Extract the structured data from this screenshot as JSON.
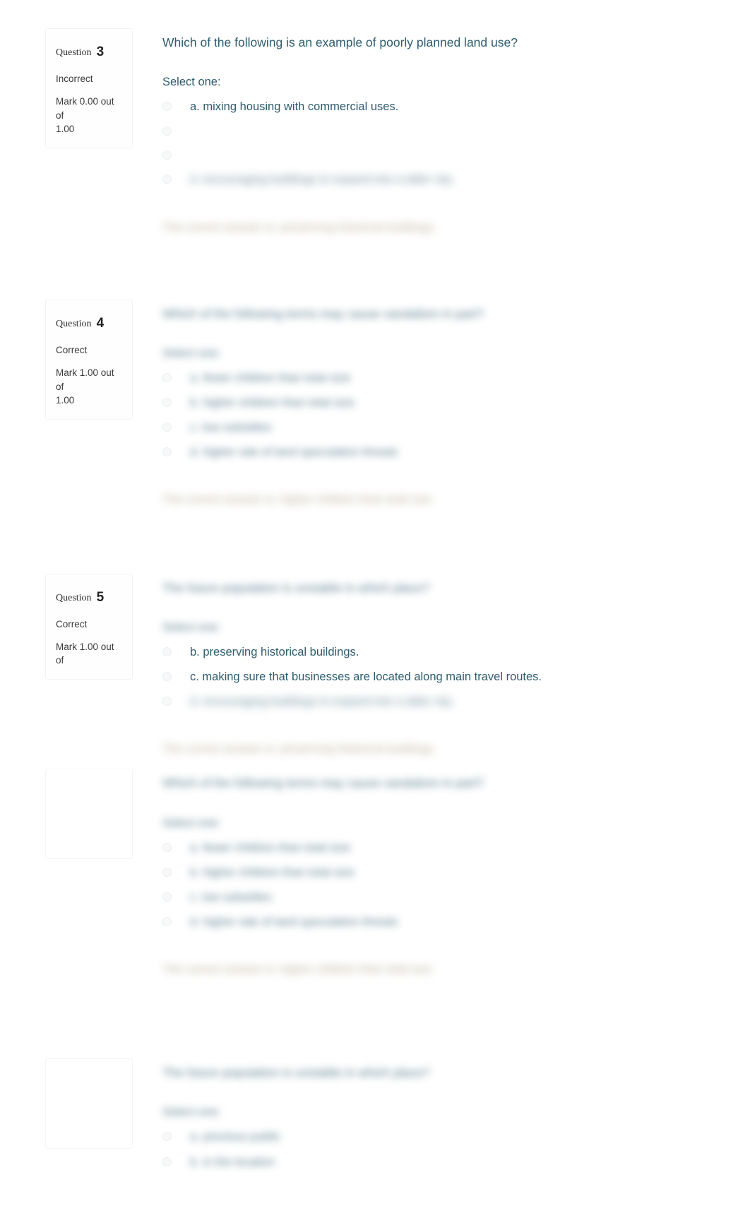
{
  "page": {
    "background": "#ffffff",
    "question_text_color": "#2e5c6e",
    "feedback_color": "#8a7250",
    "meta_text_color": "#3a3a3a"
  },
  "labels": {
    "question_word": "Question",
    "select_one": "Select one:"
  },
  "questions": [
    {
      "number": "3",
      "state": "Incorrect",
      "grade": "Mark 0.00 out of 1.00",
      "grade_line1": "Mark 0.00 out of",
      "grade_line2": "1.00",
      "text": "Which of the following is an example of poorly planned land use?",
      "text_blur": "none",
      "select_one": "Select one:",
      "select_one_blur": "none",
      "answers": [
        {
          "label": "a. mixing housing with commercial uses.",
          "blur": "none"
        },
        {
          "label": "",
          "blur": "none"
        },
        {
          "label": "",
          "blur": "none"
        },
        {
          "label": "d. encouraging buildings to expand into a taller city.",
          "blur": "max"
        }
      ],
      "feedback": "The correct answer is: preserving historical buildings.",
      "feedback_blur": "max"
    },
    {
      "number": "4",
      "state": "Correct",
      "grade": "Mark 1.00 out of 1.00",
      "grade_line1": "Mark 1.00 out of",
      "grade_line2": "1.00",
      "text": "Which of the following terms may cause vandalism in part?",
      "text_blur": "heavy",
      "select_one": "Select one:",
      "select_one_blur": "heavy",
      "answers": [
        {
          "label": "a. fewer children than total size",
          "blur": "heavy"
        },
        {
          "label": "b. higher children than total size",
          "blur": "heavy"
        },
        {
          "label": "c. low subsidies",
          "blur": "heavy"
        },
        {
          "label": "d. higher rate of land speculation threats",
          "blur": "heavy"
        }
      ],
      "feedback": "The correct answer is: higher children than total size",
      "feedback_blur": "max"
    },
    {
      "number": "5",
      "state": "Correct",
      "grade": "Mark 1.00 out of",
      "grade_line1": "Mark 1.00 out of",
      "grade_line2": "",
      "text": "The future population is unstable in which place?",
      "text_blur": "heavy",
      "select_one": "Select one:",
      "select_one_blur": "heavy",
      "answers": [
        {
          "label": "b. preserving historical buildings.",
          "blur": "none"
        },
        {
          "label": "c. making sure that businesses are located along main travel routes.",
          "blur": "none"
        },
        {
          "label": "d. encouraging buildings to expand into a taller city.",
          "blur": "max"
        }
      ],
      "feedback": "The correct answer is: preserving historical buildings.",
      "feedback_blur": "max"
    },
    {
      "number": "",
      "state": "",
      "grade": "",
      "grade_line1": "",
      "grade_line2": "",
      "text": "Which of the following terms may cause vandalism in part?",
      "text_blur": "heavy",
      "select_one": "Select one:",
      "select_one_blur": "heavy",
      "answers": [
        {
          "label": "a. fewer children than total size",
          "blur": "heavy"
        },
        {
          "label": "b. higher children than total size",
          "blur": "heavy"
        },
        {
          "label": "c. low subsidies",
          "blur": "heavy"
        },
        {
          "label": "d. higher rate of land speculation threats",
          "blur": "heavy"
        }
      ],
      "feedback": "The correct answer is: higher children than total size",
      "feedback_blur": "max"
    },
    {
      "number": "",
      "state": "",
      "grade": "",
      "grade_line1": "",
      "grade_line2": "",
      "text": "The future population is unstable in which place?",
      "text_blur": "heavy",
      "select_one": "Select one:",
      "select_one_blur": "heavy",
      "answers": [
        {
          "label": "a. previous public",
          "blur": "heavy"
        },
        {
          "label": "b. in the location",
          "blur": "heavy"
        }
      ],
      "feedback": "",
      "feedback_blur": "none"
    }
  ]
}
